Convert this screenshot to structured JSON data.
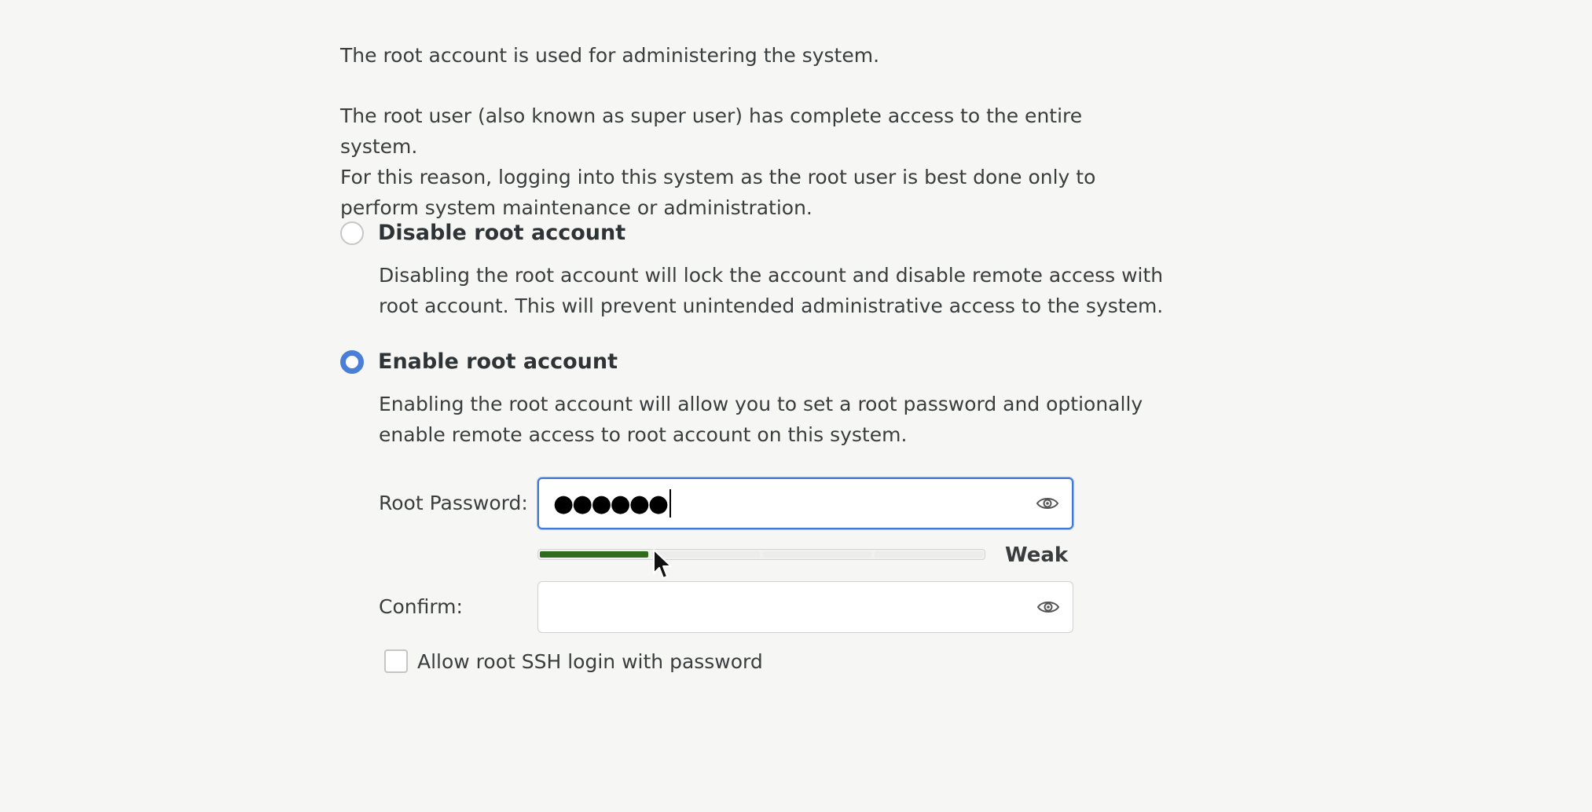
{
  "intro_text": "The root account is used for administering the system.",
  "description": {
    "line1": "The root user (also known as super user) has complete access to the entire system.",
    "line2": "For this reason, logging into this system as the root user is best done only to",
    "line3": "perform system maintenance or administration."
  },
  "options": {
    "disable": {
      "label": "Disable root account",
      "selected": false,
      "desc_line1": "Disabling the root account will lock the account and disable remote access with",
      "desc_line2": "root account. This will prevent unintended administrative access to the system."
    },
    "enable": {
      "label": "Enable root account",
      "selected": true,
      "desc_line1": "Enabling the root account will allow you to set a root password and optionally",
      "desc_line2": "enable remote access to root account on this system."
    }
  },
  "password": {
    "label": "Root Password:",
    "masked_value": "●●●●●●",
    "reveal_icon": "eye-icon"
  },
  "strength": {
    "label": "Weak",
    "level": 1,
    "max_level": 4,
    "color": "#2f6b1c"
  },
  "confirm": {
    "label": "Confirm:",
    "value": "",
    "reveal_icon": "eye-icon"
  },
  "ssh_option": {
    "label": "Allow root SSH login with password",
    "checked": false
  },
  "colors": {
    "accent": "#4a7fd8",
    "focus_border": "#3f7ad6",
    "background": "#f6f6f5"
  }
}
